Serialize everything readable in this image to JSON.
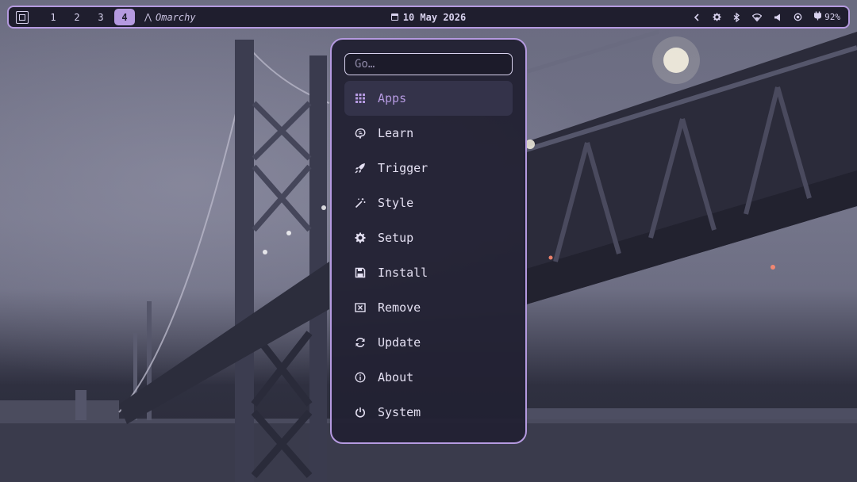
{
  "topbar": {
    "workspaces": [
      {
        "label": "1",
        "active": false
      },
      {
        "label": "2",
        "active": false
      },
      {
        "label": "3",
        "active": false
      },
      {
        "label": "4",
        "active": true
      }
    ],
    "app_title": "Omarchy",
    "date": "10 May 2026",
    "battery": "92%",
    "tray_icons": [
      "chevron-left-icon",
      "gear-icon",
      "bluetooth-icon",
      "wifi-icon",
      "volume-icon",
      "cpu-icon",
      "power-plug-icon"
    ]
  },
  "menu": {
    "search_placeholder": "Go…",
    "items": [
      {
        "label": "Apps",
        "icon": "grid-icon",
        "selected": true
      },
      {
        "label": "Learn",
        "icon": "brain-icon",
        "selected": false
      },
      {
        "label": "Trigger",
        "icon": "rocket-icon",
        "selected": false
      },
      {
        "label": "Style",
        "icon": "magic-wand-icon",
        "selected": false
      },
      {
        "label": "Setup",
        "icon": "gear-icon",
        "selected": false
      },
      {
        "label": "Install",
        "icon": "floppy-icon",
        "selected": false
      },
      {
        "label": "Remove",
        "icon": "remove-box-icon",
        "selected": false
      },
      {
        "label": "Update",
        "icon": "refresh-icon",
        "selected": false
      },
      {
        "label": "About",
        "icon": "info-icon",
        "selected": false
      },
      {
        "label": "System",
        "icon": "power-icon",
        "selected": false
      }
    ]
  },
  "colors": {
    "accent": "#b59ae0",
    "bar_bg": "#1f1e2e",
    "menu_bg": "#222133",
    "text": "#e4e0f2"
  }
}
